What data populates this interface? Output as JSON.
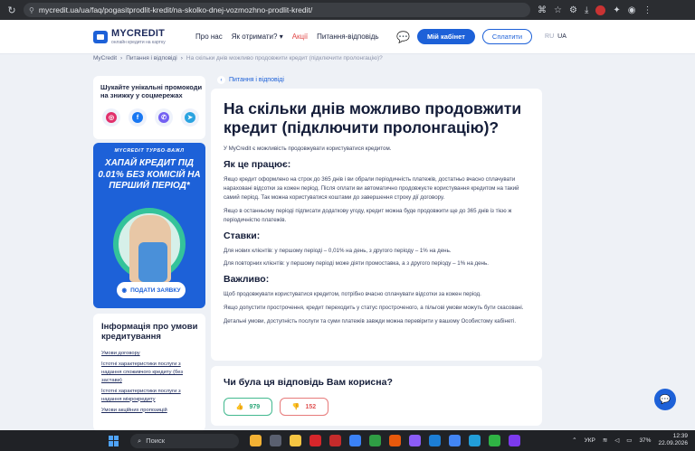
{
  "browser": {
    "url": "mycredit.ua/ua/faq/pogasitprodlit-kredit/na-skolko-dnej-vozmozhno-prodlit-kredit/"
  },
  "header": {
    "logo": "MYCREDIT",
    "logo_sub": "онлайн кредити на картку",
    "menu": [
      "Про нас",
      "Як отримати?",
      "Акції",
      "Питання-відповідь"
    ],
    "cabinet_button": "Мій кабінет",
    "pay_button": "Сплатити",
    "lang_ru": "RU",
    "lang_ua": "UA"
  },
  "breadcrumb": [
    "MyCredit",
    "Питання і відповіді",
    "На скільки днів можливо продовжити кредит (підключити пролонгацію)?"
  ],
  "sidebar": {
    "social_title": "Шукайте унікальні промокоди на знижку у соцмережах",
    "promo_top": "MYCREDIT ТУРБО-ВАЖЛ",
    "promo_title": "ХАПАЙ КРЕДИТ ПІД 0.01% БЕЗ КОМІСІЙ НА ПЕРШИЙ ПЕРІОД*",
    "promo_button": "ПОДАТИ ЗАЯВКУ",
    "info_title": "Інформація про умови кредитування",
    "info_links": [
      "Умови договору",
      "Істотні характеристики послуги з надання споживчого кредиту (без застави)",
      "Істотні характеристики послуги з надання мікрокредиту",
      "Умови акційних пропозицій"
    ]
  },
  "main": {
    "back_label": "Питання і відповіді",
    "title": "На скільки днів можливо продовжити кредит (підключити пролонгацію)?",
    "intro": "У MyCredit є можливість продовжувати користуватися кредитом.",
    "h_how": "Як це працює:",
    "p_how1": "Якщо кредит оформлено на строк до 365 днів і ви обрали періодичність платежів, достатньо вчасно сплачувати нараховані відсотки за кожен період. Після оплати ви автоматично продовжуєте користування кредитом на такий самий період. Так можна користуватися коштами до завершення строку дії договору.",
    "p_how2": "Якщо в останньому періоді підписати додаткову угоду, кредит можна буде продовжити ще до 365 днів із тією ж періодичністю платежів.",
    "h_rates": "Ставки:",
    "p_rates1": "Для нових клієнтів: у першому періоді – 0,01% на день, з другого періоду – 1% на день.",
    "p_rates2": "Для повторних клієнтів: у першому періоді може діяти промоставка, а з другого періоду – 1% на день.",
    "h_important": "Важливо:",
    "p_imp1": "Щоб продовжувати користуватися кредитом, потрібно вчасно сплачувати відсотки за кожен період.",
    "p_imp2": "Якщо допустити прострочення, кредит переходить у статус простроченого, а пільгові умови можуть бути скасовані.",
    "p_imp3": "Детальні умови, доступність послуги та суми платежів завжди можна перевірити у вашому Особистому кабінеті."
  },
  "feedback": {
    "question": "Чи була ця відповідь Вам корисна?",
    "likes": "979",
    "dislikes": "152"
  },
  "taskbar": {
    "search": "Поиск",
    "lang": "УКР",
    "battery": "37%",
    "time": "12:39",
    "date": "22.09.2026"
  },
  "colors": {
    "brand": "#1d61d8",
    "promo_green": "#34c39a",
    "like": "#2aa577",
    "dislike": "#e05656"
  }
}
